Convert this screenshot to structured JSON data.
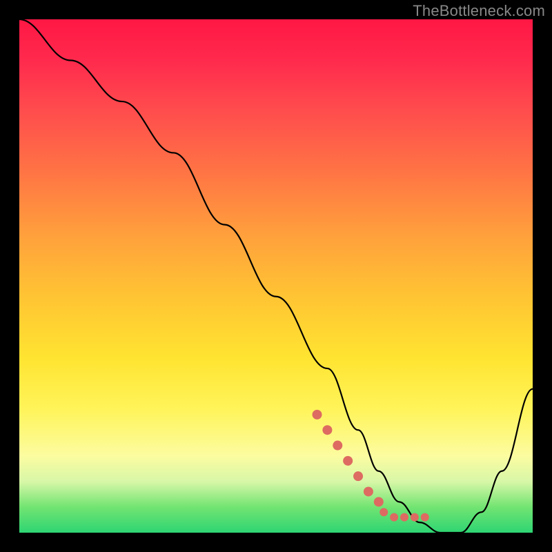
{
  "watermark": "TheBottleneck.com",
  "chart_data": {
    "type": "line",
    "title": "",
    "xlabel": "",
    "ylabel": "",
    "xlim": [
      0,
      100
    ],
    "ylim": [
      0,
      100
    ],
    "series": [
      {
        "name": "bottleneck-curve",
        "x": [
          0,
          10,
          20,
          30,
          40,
          50,
          60,
          66,
          70,
          74,
          78,
          82,
          86,
          90,
          94,
          100
        ],
        "y": [
          100,
          92,
          84,
          74,
          60,
          46,
          32,
          20,
          12,
          6,
          2,
          0,
          0,
          4,
          12,
          28
        ]
      }
    ],
    "highlight": {
      "name": "bottleneck-highlight",
      "color": "#dd6b61",
      "x": [
        58,
        60,
        62,
        64,
        66,
        68,
        70,
        71,
        73,
        75,
        77,
        79
      ],
      "y": [
        23,
        20,
        17,
        14,
        11,
        8,
        6,
        4,
        3,
        3,
        3,
        3
      ]
    },
    "gradient_stops": [
      {
        "pos": 0,
        "color": "#ff1744"
      },
      {
        "pos": 18,
        "color": "#ff4d4d"
      },
      {
        "pos": 42,
        "color": "#ffa03c"
      },
      {
        "pos": 66,
        "color": "#ffe431"
      },
      {
        "pos": 85,
        "color": "#fcfca0"
      },
      {
        "pos": 95,
        "color": "#72e472"
      },
      {
        "pos": 100,
        "color": "#2ed573"
      }
    ]
  }
}
